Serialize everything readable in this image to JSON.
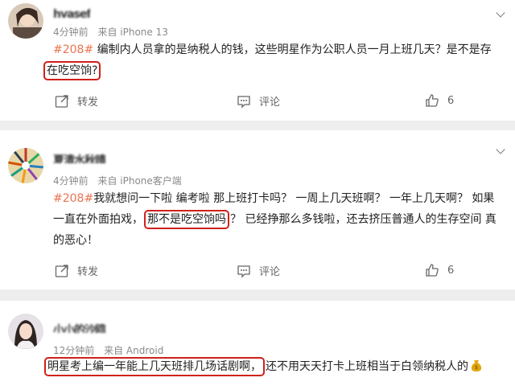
{
  "posts": [
    {
      "username": "hvasef",
      "time": "4分钟前",
      "source": "来自 iPhone 13",
      "tag": "#208#",
      "line1_text": " 编制内人员拿的是纳税人的钱，这些明星作为公职人员一月上班几天？是不是存",
      "boxed": "在吃空饷?",
      "repost_label": "转发",
      "comment_label": "评论",
      "like_count": "6"
    },
    {
      "username": "夏清水秋晴",
      "time": "4分钟前",
      "source": "来自 iPhone客户端",
      "tag": "#208#",
      "line1_text": "我就想问一下啦 编考啦 那上班打卡吗？ 一周上几天班啊？ 一年上几天啊？ 如果",
      "line2_pre": "一直在外面拍戏，",
      "boxed": "那不是吃空饷吗",
      "line2_post": "？ 已经挣那么多钱啦，还去挤压普通人的生存空间 真",
      "line3_text": "的恶心！",
      "repost_label": "转发",
      "comment_label": "评论",
      "like_count": "6"
    },
    {
      "username": "小小的沙鸥",
      "time": "12分钟前",
      "source": "来自 Android",
      "boxed": "明星考上编一年能上几天班排几场话剧啊，",
      "line1_post": "还不用天天打卡上班相当于白领纳税人的"
    }
  ]
}
